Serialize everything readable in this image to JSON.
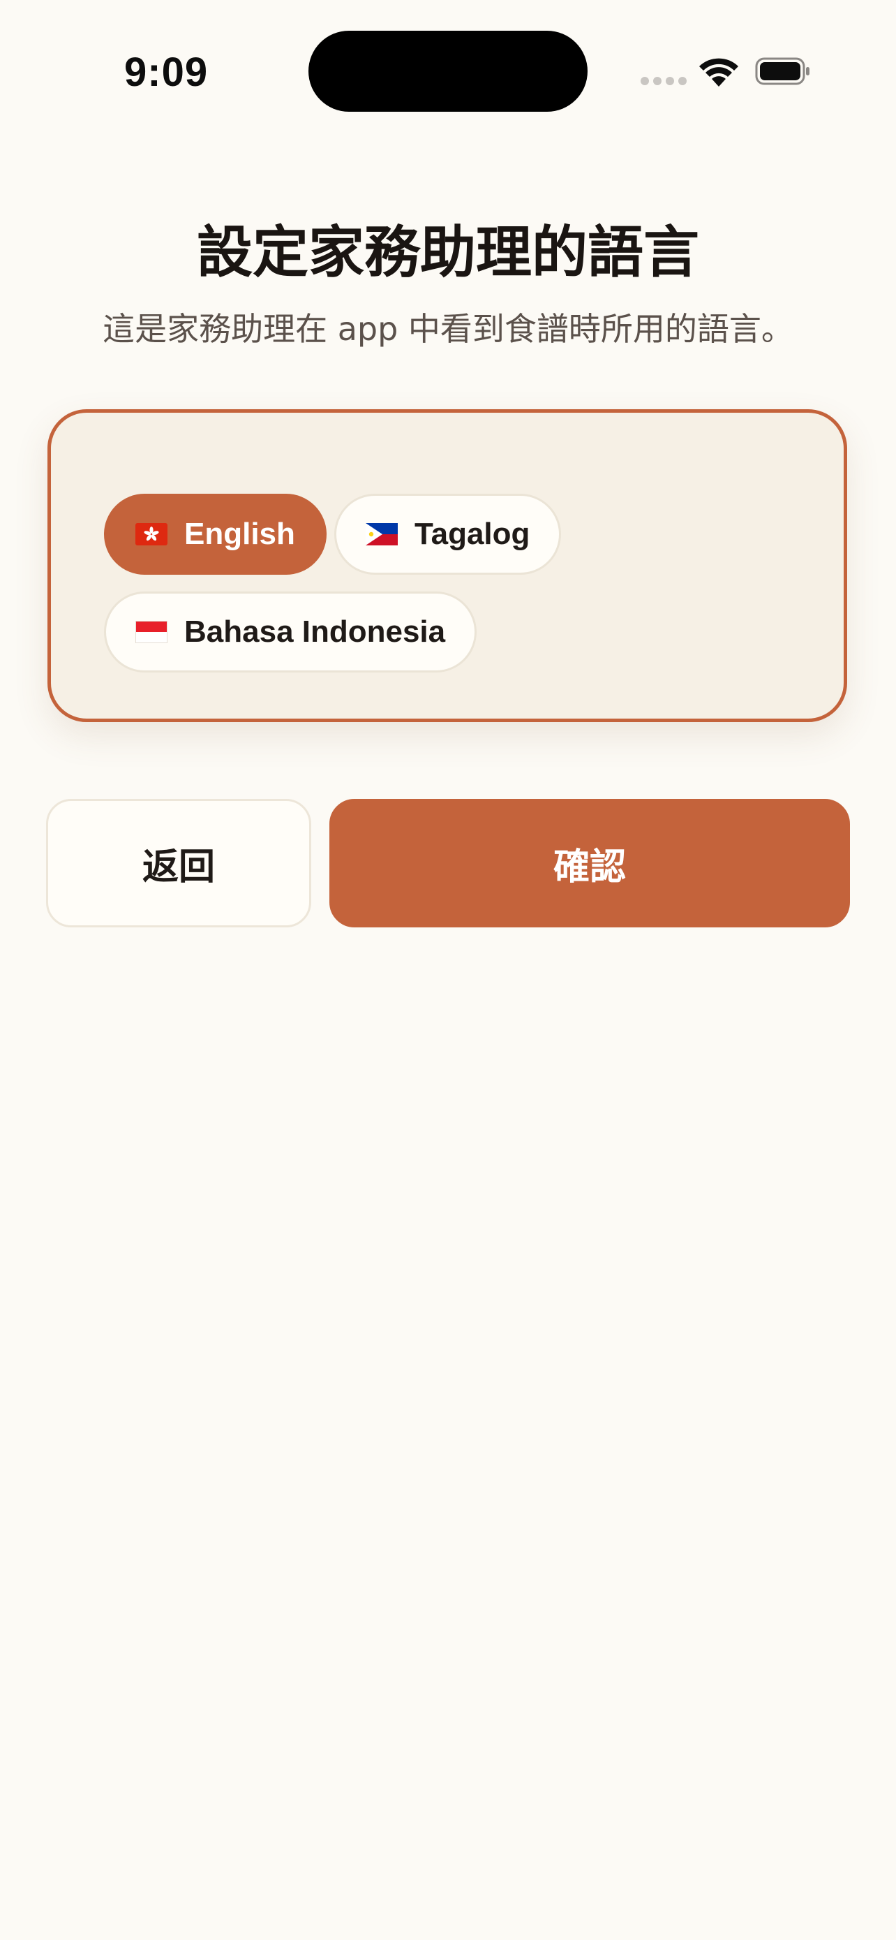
{
  "status_bar": {
    "time": "9:09",
    "icons": [
      "cellular-signal-icon",
      "wifi-icon",
      "battery-icon"
    ]
  },
  "header": {
    "title": "設定家務助理的語言",
    "subtitle": "這是家務助理在 app 中看到食譜時所用的語言。"
  },
  "languages": {
    "options": [
      {
        "label": "English",
        "flag": "hong-kong-flag-icon",
        "selected": true
      },
      {
        "label": "Tagalog",
        "flag": "philippines-flag-icon",
        "selected": false
      },
      {
        "label": "Bahasa Indonesia",
        "flag": "indonesia-flag-icon",
        "selected": false
      }
    ]
  },
  "actions": {
    "back_label": "返回",
    "confirm_label": "確認"
  },
  "colors": {
    "accent": "#c4633b",
    "background": "#fcfaf5",
    "card_background": "#f6f0e5",
    "chip_background": "#fffdf8",
    "title_text": "#1a1512",
    "subtitle_text": "#5b514b"
  }
}
